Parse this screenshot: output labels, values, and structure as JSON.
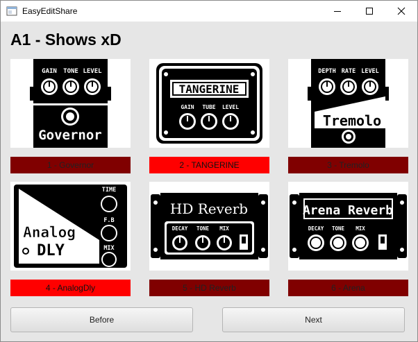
{
  "window": {
    "title": "EasyEditShare"
  },
  "preset": {
    "title": "A1 - Shows xD"
  },
  "pedals": [
    {
      "label": "1 - Governor",
      "active": false,
      "image_text": "Governor",
      "knobs": [
        "GAIN",
        "TONE",
        "LEVEL"
      ]
    },
    {
      "label": "2 - TANGERINE",
      "active": true,
      "image_text": "TANGERINE",
      "knobs": [
        "GAIN",
        "TUBE",
        "LEVEL"
      ]
    },
    {
      "label": "3 - Tremolo",
      "active": false,
      "image_text": "Tremolo",
      "knobs": [
        "DEPTH",
        "RATE",
        "LEVEL"
      ]
    },
    {
      "label": "4 - AnalogDly",
      "active": true,
      "image_text": [
        "Analog",
        "DLY"
      ],
      "knobs": [
        "TIME",
        "F.B",
        "MIX"
      ]
    },
    {
      "label": "5 - HD Reverb",
      "active": false,
      "image_text": "HD Reverb",
      "knobs": [
        "DECAY",
        "TONE",
        "MIX"
      ]
    },
    {
      "label": "6 - Arena",
      "active": false,
      "image_text": "Arena Reverb",
      "knobs": [
        "DECAY",
        "TONE",
        "MIX"
      ]
    }
  ],
  "nav": {
    "before_label": "Before",
    "next_label": "Next"
  },
  "colors": {
    "active": "#ff0000",
    "inactive": "#800000"
  }
}
